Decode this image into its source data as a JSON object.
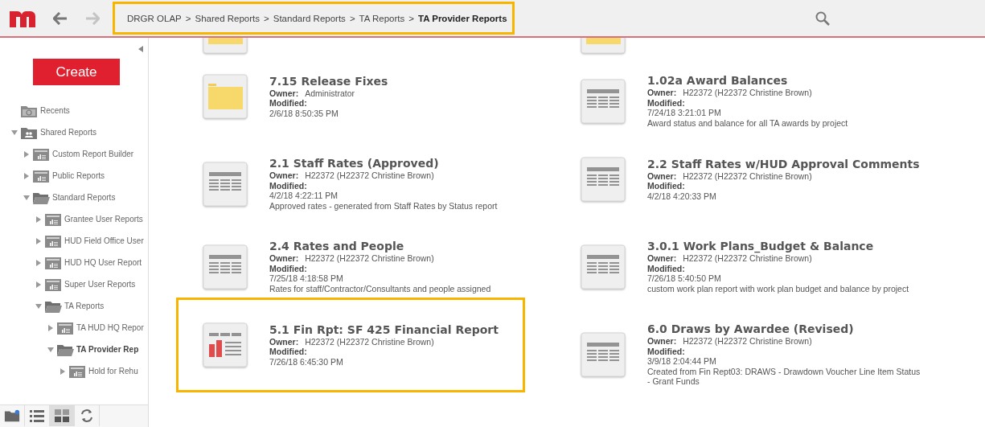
{
  "header": {
    "highlighted": true,
    "separator": ">",
    "breadcrumb": [
      {
        "label": "DRGR OLAP",
        "current": false
      },
      {
        "label": "Shared Reports",
        "current": false
      },
      {
        "label": "Standard Reports",
        "current": false
      },
      {
        "label": "TA Reports",
        "current": false
      },
      {
        "label": "TA Provider Reports",
        "current": true
      }
    ]
  },
  "sidebar": {
    "create_button": "Create",
    "tree": [
      {
        "label": "Recents",
        "kind": "recents",
        "selected": false
      },
      {
        "label": "Shared Reports",
        "kind": "shared",
        "expanded": true,
        "selected": false,
        "children": [
          {
            "label": "Custom Report Builder",
            "kind": "report",
            "expanded": false,
            "selected": false
          },
          {
            "label": "Public Reports",
            "kind": "report",
            "expanded": false,
            "selected": false
          },
          {
            "label": "Standard Reports",
            "kind": "folder",
            "expanded": true,
            "selected": false,
            "children": [
              {
                "label": "Grantee User Reports",
                "kind": "report",
                "expanded": false,
                "selected": false
              },
              {
                "label": "HUD Field Office User",
                "kind": "report",
                "expanded": false,
                "selected": false
              },
              {
                "label": "HUD HQ User Report",
                "kind": "report",
                "expanded": false,
                "selected": false
              },
              {
                "label": "Super User Reports",
                "kind": "report",
                "expanded": false,
                "selected": false
              },
              {
                "label": "TA Reports",
                "kind": "folder",
                "expanded": true,
                "selected": false,
                "children": [
                  {
                    "label": "TA HUD HQ Repor",
                    "kind": "report",
                    "expanded": false,
                    "selected": false
                  },
                  {
                    "label": "TA Provider Rep",
                    "kind": "folder",
                    "expanded": true,
                    "selected": true,
                    "children": [
                      {
                        "label": "Hold for Rehu",
                        "kind": "report",
                        "expanded": false,
                        "selected": false
                      }
                    ]
                  }
                ]
              }
            ]
          }
        ]
      }
    ],
    "view_buttons": [
      {
        "kind": "new-folder",
        "selected": false
      },
      {
        "kind": "list",
        "selected": false
      },
      {
        "kind": "grid",
        "selected": true
      },
      {
        "kind": "refresh",
        "selected": false
      }
    ]
  },
  "reports": [
    {
      "kind": "folder"
    },
    {
      "kind": "folder"
    },
    {
      "kind": "folder",
      "highlighted": false,
      "title": "7.15 Release Fixes",
      "owner_label": "Owner:",
      "owner": "Administrator",
      "modified_label": "Modified:",
      "modified": "2/6/18 8:50:35 PM"
    },
    {
      "kind": "table",
      "highlighted": false,
      "title": "1.02a Award Balances",
      "owner_label": "Owner:",
      "owner": "H22372 (H22372 Christine Brown)",
      "modified_label": "Modified:",
      "modified": "7/24/18 3:21:01 PM",
      "description": "Award status and balance for all TA awards by project"
    },
    {
      "kind": "table",
      "highlighted": false,
      "title": "2.1 Staff Rates (Approved)",
      "owner_label": "Owner:",
      "owner": "H22372 (H22372 Christine Brown)",
      "modified_label": "Modified:",
      "modified": "4/2/18 4:22:11 PM",
      "description": "Approved rates - generated from Staff Rates by Status report"
    },
    {
      "kind": "table",
      "highlighted": false,
      "title": "2.2 Staff Rates w/HUD Approval Comments",
      "owner_label": "Owner:",
      "owner": "H22372 (H22372 Christine Brown)",
      "modified_label": "Modified:",
      "modified": "4/2/18 4:20:33 PM"
    },
    {
      "kind": "table",
      "highlighted": false,
      "title": "2.4 Rates and People",
      "owner_label": "Owner:",
      "owner": "H22372 (H22372 Christine Brown)",
      "modified_label": "Modified:",
      "modified": "7/25/18 4:18:58 PM",
      "description": "Rates for staff/Contractor/Consultants and people assigned"
    },
    {
      "kind": "table",
      "highlighted": false,
      "title": "3.0.1 Work Plans_Budget & Balance",
      "owner_label": "Owner:",
      "owner": "H22372 (H22372 Christine Brown)",
      "modified_label": "Modified:",
      "modified": "7/26/18 5:40:50 PM",
      "description": "custom work plan report with work plan budget and balance by project"
    },
    {
      "kind": "chart",
      "highlighted": true,
      "title": "5.1 Fin Rpt: SF 425 Financial Report",
      "owner_label": "Owner:",
      "owner": "H22372 (H22372 Christine Brown)",
      "modified_label": "Modified:",
      "modified": "7/26/18 6:45:30 PM"
    },
    {
      "kind": "table",
      "highlighted": false,
      "title": "6.0 Draws by Awardee (Revised)",
      "owner_label": "Owner:",
      "owner": "H22372 (H22372 Christine Brown)",
      "modified_label": "Modified:",
      "modified": "3/9/18 2:04:44 PM",
      "description": "Created from Fin Rept03: DRAWS - Drawdown Voucher Line Item Status - Grant Funds"
    }
  ]
}
